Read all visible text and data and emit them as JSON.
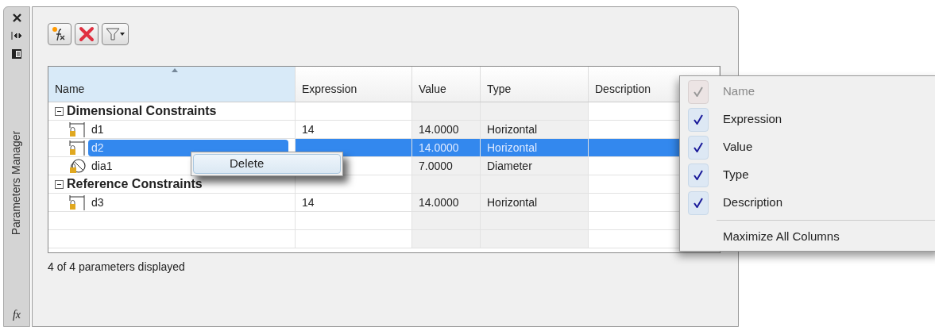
{
  "side_strip": {
    "title": "Parameters Manager",
    "icon_label": "fx"
  },
  "toolbar": [
    {
      "kind": "new"
    },
    {
      "kind": "delete"
    },
    {
      "kind": "filter"
    }
  ],
  "table": {
    "columns": [
      {
        "label": "Name",
        "sorted": true
      },
      {
        "label": "Expression",
        "sorted": false
      },
      {
        "label": "Value",
        "sorted": false
      },
      {
        "label": "Type",
        "sorted": false
      },
      {
        "label": "Description",
        "sorted": false
      }
    ],
    "groups": [
      {
        "label": "Dimensional Constraints",
        "expanded": true,
        "rows": [
          {
            "kind": "linear",
            "name": "d1",
            "expression": "14",
            "value": "14.0000",
            "type": "Horizontal",
            "selected": false
          },
          {
            "kind": "linear",
            "name": "d2",
            "value": "14.0000",
            "type": "Horizontal",
            "selected": true
          },
          {
            "kind": "diameter",
            "name": "dia1",
            "value": "7.0000",
            "type": "Diameter",
            "selected": false
          }
        ]
      },
      {
        "label": "Reference Constraints",
        "expanded": true,
        "rows": [
          {
            "kind": "linear",
            "name": "d3",
            "expression": "14",
            "value": "14.0000",
            "type": "Horizontal",
            "selected": false
          }
        ]
      }
    ]
  },
  "status": "4 of 4 parameters displayed",
  "row_menu": {
    "items": [
      "Delete"
    ]
  },
  "column_menu": {
    "items": [
      {
        "label": "Name",
        "checked": true,
        "disabled": true
      },
      {
        "label": "Expression",
        "checked": true,
        "disabled": false
      },
      {
        "label": "Value",
        "checked": true,
        "disabled": false
      },
      {
        "label": "Type",
        "checked": true,
        "disabled": false
      },
      {
        "label": "Description",
        "checked": true,
        "disabled": false
      }
    ],
    "action": "Maximize All Columns"
  }
}
